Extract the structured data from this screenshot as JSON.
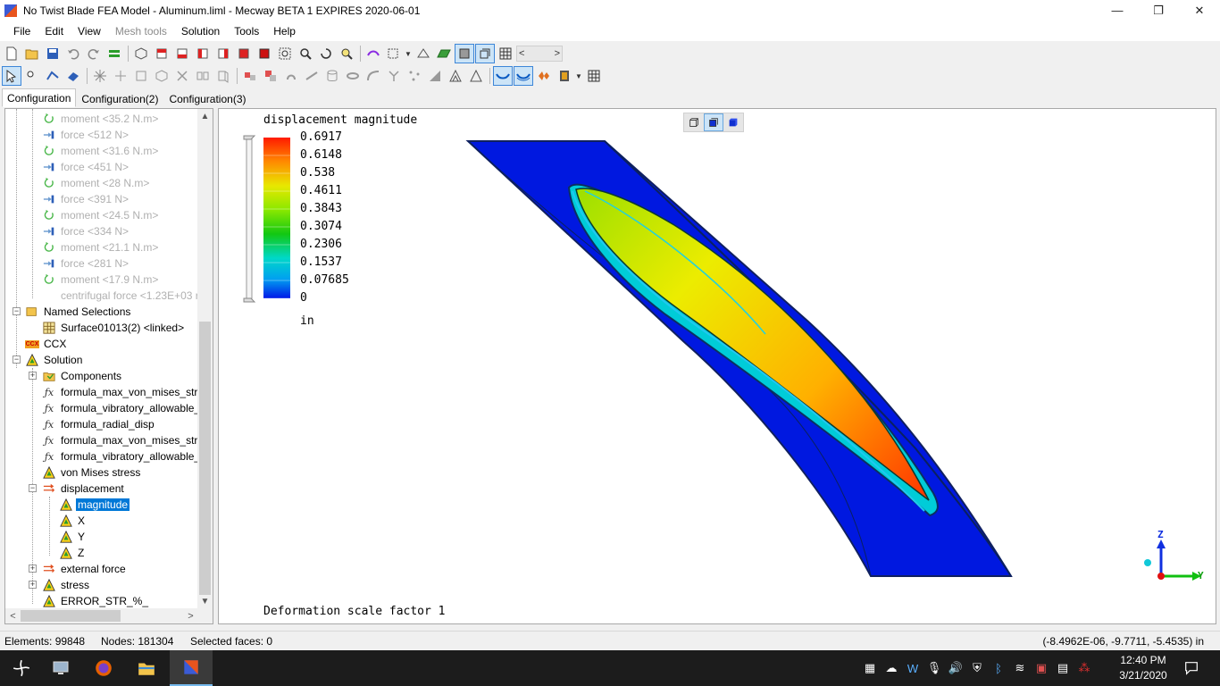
{
  "window": {
    "title": "No Twist Blade FEA Model - Aluminum.liml - Mecway BETA 1 EXPIRES 2020-06-01",
    "minimize": "—",
    "restore": "❐",
    "close": "✕"
  },
  "menu": [
    "File",
    "Edit",
    "View",
    "Mesh tools",
    "Solution",
    "Tools",
    "Help"
  ],
  "tabs": [
    "Configuration",
    "Configuration(2)",
    "Configuration(3)"
  ],
  "tree": {
    "greyed": [
      {
        "label": "moment <35.2 N.m>",
        "icon": "moment-icon"
      },
      {
        "label": "force <512 N>",
        "icon": "force-icon"
      },
      {
        "label": "moment <31.6 N.m>",
        "icon": "moment-icon"
      },
      {
        "label": "force <451 N>",
        "icon": "force-icon"
      },
      {
        "label": "moment <28 N.m>",
        "icon": "moment-icon"
      },
      {
        "label": "force <391 N>",
        "icon": "force-icon"
      },
      {
        "label": "moment <24.5 N.m>",
        "icon": "moment-icon"
      },
      {
        "label": "force <334 N>",
        "icon": "force-icon"
      },
      {
        "label": "moment <21.1 N.m>",
        "icon": "moment-icon"
      },
      {
        "label": "force <281 N>",
        "icon": "force-icon"
      },
      {
        "label": "moment <17.9 N.m>",
        "icon": "moment-icon"
      },
      {
        "label": "centrifugal force <1.23E+03 r",
        "icon": ""
      }
    ],
    "named_selections": "Named Selections",
    "surface": "Surface01013(2) <linked>",
    "ccx": "CCX",
    "ccx_icon_text": "CCX",
    "solution": "Solution",
    "components": "Components",
    "formulas": [
      "formula_max_von_mises_stre",
      "formula_vibratory_allowable_",
      "formula_radial_disp",
      "formula_max_von_mises_stre",
      "formula_vibratory_allowable_"
    ],
    "formula_icon_text": "ƒx",
    "von_mises": "von Mises stress",
    "displacement": "displacement",
    "magnitude": "magnitude",
    "axes": [
      "X",
      "Y",
      "Z"
    ],
    "external_force": "external force",
    "stress": "stress",
    "error": "ERROR_STR_%_"
  },
  "viewport": {
    "legend_title": "displacement magnitude",
    "legend_values": [
      "0.6917",
      "0.6148",
      "0.538",
      "0.4611",
      "0.3843",
      "0.3074",
      "0.2306",
      "0.1537",
      "0.07685",
      "0"
    ],
    "legend_unit": "in",
    "deformation_scale": "Deformation scale factor 1",
    "triad": {
      "z": "Z",
      "y": "Y"
    }
  },
  "status": {
    "elements": "Elements: 99848",
    "nodes": "Nodes: 181304",
    "selected": "Selected faces: 0",
    "coords": "(-8.4962E-06, -9.7711, -5.4535) in"
  },
  "taskbar": {
    "time": "12:40 PM",
    "date": "3/21/2020"
  },
  "colors": {
    "selection": "#0078d7",
    "legend_high": "#ff0000",
    "legend_low": "#0000ff",
    "blade": "#0018e0"
  }
}
